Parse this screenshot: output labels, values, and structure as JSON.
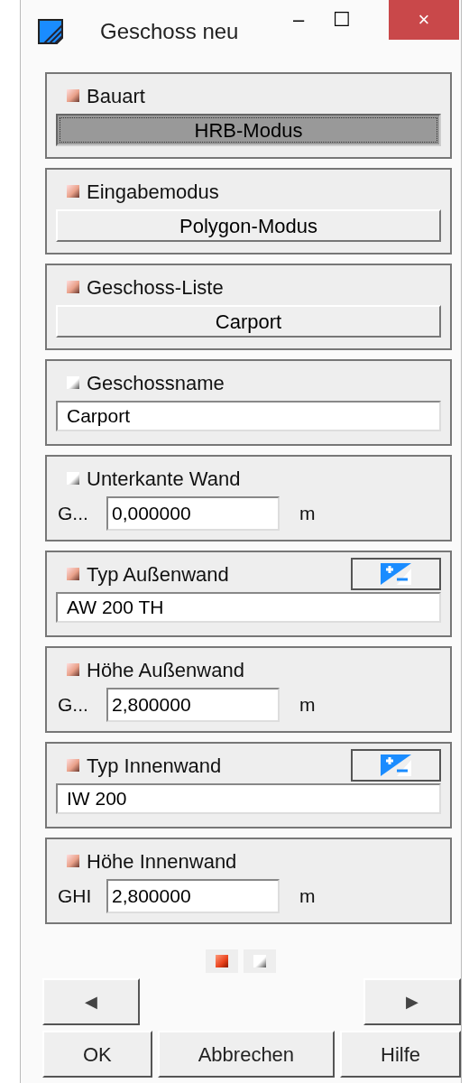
{
  "window": {
    "title": "Geschoss neu",
    "controls": [
      "–",
      "☐",
      "×"
    ]
  },
  "sections": [
    {
      "label": "Bauart",
      "active": true,
      "kind": "button",
      "value": "HRB-Modus",
      "pressed": true
    },
    {
      "label": "Eingabemodus",
      "active": true,
      "kind": "button",
      "value": "Polygon-Modus",
      "pressed": false
    },
    {
      "label": "Geschoss-Liste",
      "active": true,
      "kind": "button",
      "value": "Carport",
      "pressed": false
    },
    {
      "label": "Geschossname",
      "active": false,
      "kind": "field",
      "value": "Carport"
    },
    {
      "label": "Unterkante Wand",
      "active": false,
      "kind": "unit",
      "prefix": "G...",
      "value": "0,000000",
      "unit": "m"
    },
    {
      "label": "Typ Außenwand",
      "active": true,
      "kind": "typefield",
      "value": "AW 200 TH"
    },
    {
      "label": "Höhe Außenwand",
      "active": true,
      "kind": "unit",
      "prefix": "G...",
      "value": "2,800000",
      "unit": "m"
    },
    {
      "label": "Typ Innenwand",
      "active": true,
      "kind": "typefield",
      "value": "IW 200"
    },
    {
      "label": "Höhe Innenwand",
      "active": true,
      "kind": "unit",
      "prefix": "GHI",
      "value": "2,800000",
      "unit": "m"
    }
  ],
  "pages": [
    {
      "selected": true
    },
    {
      "selected": false
    }
  ],
  "nav": [
    "◀",
    "▶"
  ],
  "buttons": [
    "OK",
    "Abbrechen",
    "Hilfe"
  ]
}
